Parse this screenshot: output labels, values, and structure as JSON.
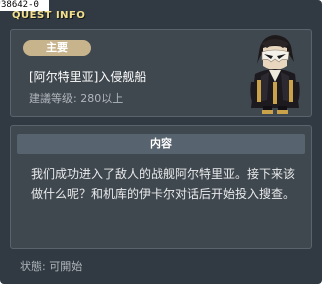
{
  "window": {
    "id_tag": "38642-0",
    "title": "QUEST INFO"
  },
  "quest": {
    "badge": "主要",
    "name": "[阿尔特里亚]入侵舰船",
    "level_requirement": "建議等级: 280以上",
    "npc_icon": "masked-character-icon"
  },
  "content": {
    "header": "内容",
    "text": "我们成功进入了敌人的战舰阿尔特里亚。接下来该做什么呢？和机库的伊卡尔对话后开始投入搜查。"
  },
  "status": {
    "text": "状態:  可開始"
  },
  "colors": {
    "background": "#313a42",
    "panel": "#40484f",
    "title": "#f3e08c",
    "badge": "#c8b48c",
    "content_header": "#57636e"
  }
}
